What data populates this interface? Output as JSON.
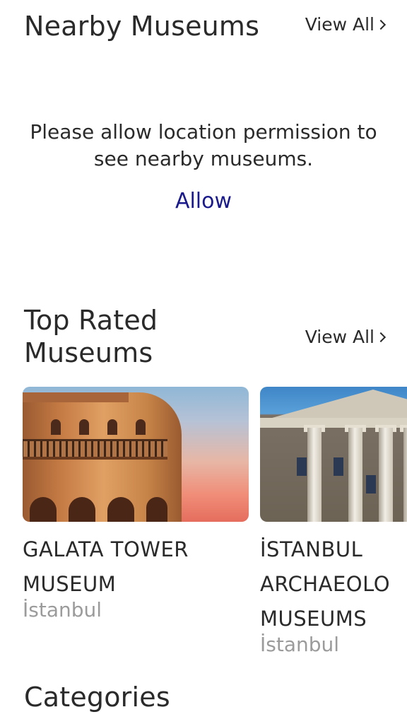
{
  "nearby": {
    "title": "Nearby Museums",
    "view_all": "View All",
    "permission_text": "Please allow location permission to see nearby museums.",
    "allow_label": "Allow"
  },
  "top_rated": {
    "title": "Top Rated Museums",
    "view_all": "View All",
    "museums": [
      {
        "name": "GALATA TOWER\nMUSEUM",
        "city": "İstanbul"
      },
      {
        "name": "İSTANBUL\nARCHAEOLO\nMUSEUMS",
        "city": "İstanbul"
      }
    ]
  },
  "categories": {
    "title": "Categories"
  },
  "colors": {
    "allow_link": "#1a1a8c",
    "city_text": "#9b9b9b",
    "primary_text": "#2a2a2a"
  }
}
